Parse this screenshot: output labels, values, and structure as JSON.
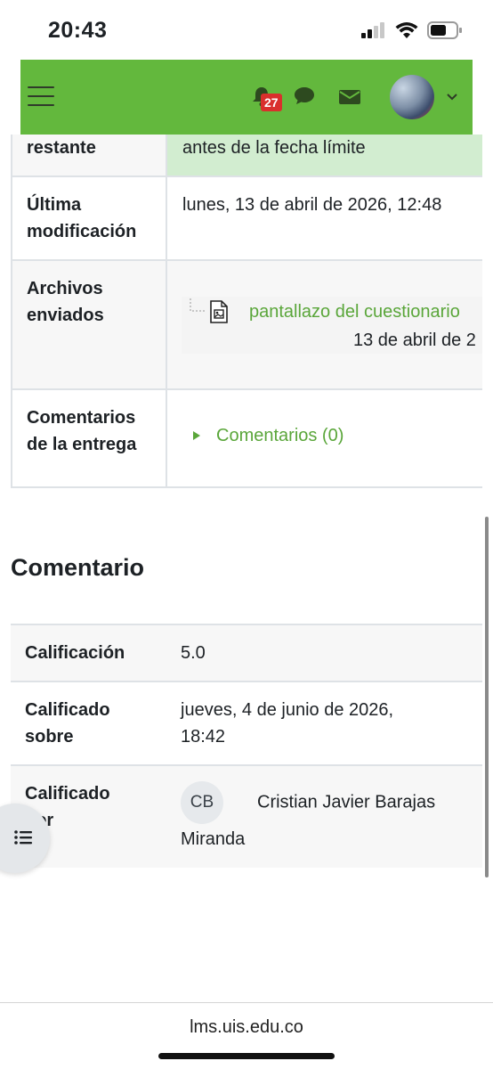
{
  "status_bar": {
    "time": "20:43"
  },
  "navbar": {
    "notification_count": "27"
  },
  "submission": {
    "remaining_label": "restante",
    "remaining_value": "antes de la fecha límite",
    "modified_label_1": "Última",
    "modified_label_2": "modificación",
    "modified_value": "lunes, 13 de abril de 2026, 12:48",
    "files_label_1": "Archivos",
    "files_label_2": "enviados",
    "file_name": "pantallazo del cuestionario",
    "file_date": "13 de abril de 2",
    "comments_label_1": "Comentarios",
    "comments_label_2": "de la entrega",
    "comments_link": "Comentarios (0)"
  },
  "feedback": {
    "heading": "Comentario",
    "grade_label": "Calificación",
    "grade_value": "5.0",
    "graded_on_label_1": "Calificado",
    "graded_on_label_2": "sobre",
    "graded_on_value_1": "jueves, 4 de junio de 2026,",
    "graded_on_value_2": "18:42",
    "graded_by_label_1": "Calificado",
    "graded_by_label_2": "por",
    "grader_initials": "CB",
    "grader_name_1": "Cristian Javier Barajas",
    "grader_name_2": "Miranda"
  },
  "browser": {
    "url": "lms.uis.edu.co"
  },
  "colors": {
    "brand_green": "#63b83d",
    "link_green": "#5aa63a",
    "badge_red": "#d9302c"
  }
}
